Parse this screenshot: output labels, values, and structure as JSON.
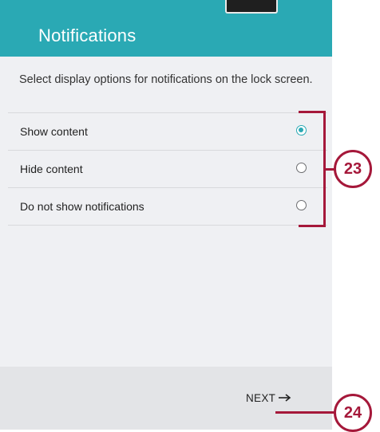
{
  "header": {
    "title": "Notifications"
  },
  "description": "Select display options for notifications on the lock screen.",
  "options": [
    {
      "label": "Show content",
      "selected": true
    },
    {
      "label": "Hide content",
      "selected": false
    },
    {
      "label": "Do not show notifications",
      "selected": false
    }
  ],
  "footer": {
    "next_label": "NEXT",
    "next_icon": "arrow-right-icon"
  },
  "callouts": [
    {
      "number": "23"
    },
    {
      "number": "24"
    }
  ],
  "colors": {
    "accent": "#2aa9b4",
    "callout": "#a5183a",
    "background": "#eff0f3"
  }
}
